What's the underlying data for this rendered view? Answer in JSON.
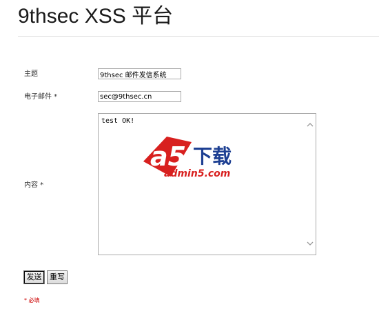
{
  "header": {
    "title": "9thsec XSS 平台"
  },
  "form": {
    "subject": {
      "label": "主题",
      "value": "9thsec 邮件发信系统"
    },
    "email": {
      "label": "电子邮件 *",
      "value": "sec@9thsec.cn"
    },
    "content": {
      "label": "内容 *",
      "value": "test OK!"
    },
    "buttons": {
      "send_label": "发送",
      "reset_label": "重写"
    },
    "required_note": "* 必填"
  },
  "watermark": {
    "brand_mark": "a5",
    "brand_text": "下载",
    "domain": "admin5.com"
  },
  "colors": {
    "watermark_red": "#d8201f",
    "watermark_blue": "#1d3f92",
    "required_red": "#cc0000"
  },
  "icons": {
    "scroll_up": "chevron-up-icon",
    "scroll_down": "chevron-down-icon",
    "watermark_logo": "a5-logo-icon"
  }
}
